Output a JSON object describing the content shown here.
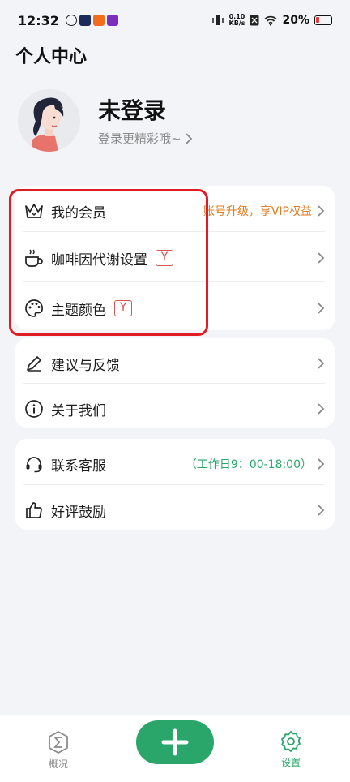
{
  "status_bar": {
    "time": "12:32",
    "net_speed_value": "0.10",
    "net_speed_unit": "KB/s",
    "battery": "20%"
  },
  "header": {
    "title": "个人中心"
  },
  "profile": {
    "name": "未登录",
    "subtitle": "登录更精彩哦~"
  },
  "menu_group_1": [
    {
      "label": "我的会员",
      "extra": "账号升级，享VIP权益",
      "icon": "crown-icon"
    },
    {
      "label": "咖啡因代谢设置",
      "badge": "Y",
      "icon": "coffee-cup-icon"
    },
    {
      "label": "主题颜色",
      "badge": "Y",
      "icon": "palette-icon"
    }
  ],
  "menu_group_2": [
    {
      "label": "建议与反馈",
      "icon": "pencil-icon"
    },
    {
      "label": "关于我们",
      "icon": "info-icon"
    }
  ],
  "menu_group_3": [
    {
      "label": "联系客服",
      "extra": "（工作日9：00-18:00）",
      "icon": "headset-icon"
    },
    {
      "label": "好评鼓励",
      "icon": "thumbs-up-icon"
    }
  ],
  "bottom_nav": {
    "overview_label": "概况",
    "settings_label": "设置"
  },
  "colors": {
    "accent": "#2aa66b",
    "vip_text": "#e07a1f",
    "annotation": "#e01b24"
  }
}
